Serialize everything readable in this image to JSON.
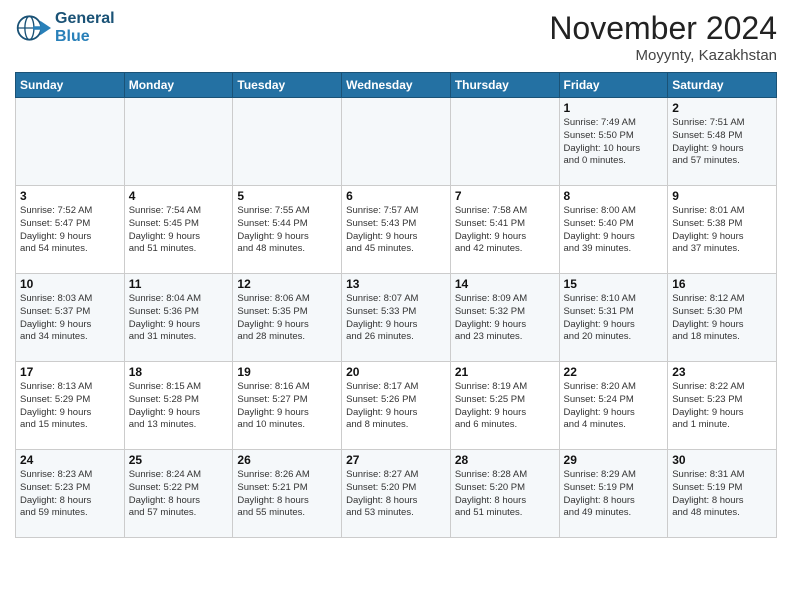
{
  "header": {
    "logo_line1": "General",
    "logo_line2": "Blue",
    "month": "November 2024",
    "location": "Moyynty, Kazakhstan"
  },
  "weekdays": [
    "Sunday",
    "Monday",
    "Tuesday",
    "Wednesday",
    "Thursday",
    "Friday",
    "Saturday"
  ],
  "weeks": [
    [
      {
        "day": "",
        "info": ""
      },
      {
        "day": "",
        "info": ""
      },
      {
        "day": "",
        "info": ""
      },
      {
        "day": "",
        "info": ""
      },
      {
        "day": "",
        "info": ""
      },
      {
        "day": "1",
        "info": "Sunrise: 7:49 AM\nSunset: 5:50 PM\nDaylight: 10 hours\nand 0 minutes."
      },
      {
        "day": "2",
        "info": "Sunrise: 7:51 AM\nSunset: 5:48 PM\nDaylight: 9 hours\nand 57 minutes."
      }
    ],
    [
      {
        "day": "3",
        "info": "Sunrise: 7:52 AM\nSunset: 5:47 PM\nDaylight: 9 hours\nand 54 minutes."
      },
      {
        "day": "4",
        "info": "Sunrise: 7:54 AM\nSunset: 5:45 PM\nDaylight: 9 hours\nand 51 minutes."
      },
      {
        "day": "5",
        "info": "Sunrise: 7:55 AM\nSunset: 5:44 PM\nDaylight: 9 hours\nand 48 minutes."
      },
      {
        "day": "6",
        "info": "Sunrise: 7:57 AM\nSunset: 5:43 PM\nDaylight: 9 hours\nand 45 minutes."
      },
      {
        "day": "7",
        "info": "Sunrise: 7:58 AM\nSunset: 5:41 PM\nDaylight: 9 hours\nand 42 minutes."
      },
      {
        "day": "8",
        "info": "Sunrise: 8:00 AM\nSunset: 5:40 PM\nDaylight: 9 hours\nand 39 minutes."
      },
      {
        "day": "9",
        "info": "Sunrise: 8:01 AM\nSunset: 5:38 PM\nDaylight: 9 hours\nand 37 minutes."
      }
    ],
    [
      {
        "day": "10",
        "info": "Sunrise: 8:03 AM\nSunset: 5:37 PM\nDaylight: 9 hours\nand 34 minutes."
      },
      {
        "day": "11",
        "info": "Sunrise: 8:04 AM\nSunset: 5:36 PM\nDaylight: 9 hours\nand 31 minutes."
      },
      {
        "day": "12",
        "info": "Sunrise: 8:06 AM\nSunset: 5:35 PM\nDaylight: 9 hours\nand 28 minutes."
      },
      {
        "day": "13",
        "info": "Sunrise: 8:07 AM\nSunset: 5:33 PM\nDaylight: 9 hours\nand 26 minutes."
      },
      {
        "day": "14",
        "info": "Sunrise: 8:09 AM\nSunset: 5:32 PM\nDaylight: 9 hours\nand 23 minutes."
      },
      {
        "day": "15",
        "info": "Sunrise: 8:10 AM\nSunset: 5:31 PM\nDaylight: 9 hours\nand 20 minutes."
      },
      {
        "day": "16",
        "info": "Sunrise: 8:12 AM\nSunset: 5:30 PM\nDaylight: 9 hours\nand 18 minutes."
      }
    ],
    [
      {
        "day": "17",
        "info": "Sunrise: 8:13 AM\nSunset: 5:29 PM\nDaylight: 9 hours\nand 15 minutes."
      },
      {
        "day": "18",
        "info": "Sunrise: 8:15 AM\nSunset: 5:28 PM\nDaylight: 9 hours\nand 13 minutes."
      },
      {
        "day": "19",
        "info": "Sunrise: 8:16 AM\nSunset: 5:27 PM\nDaylight: 9 hours\nand 10 minutes."
      },
      {
        "day": "20",
        "info": "Sunrise: 8:17 AM\nSunset: 5:26 PM\nDaylight: 9 hours\nand 8 minutes."
      },
      {
        "day": "21",
        "info": "Sunrise: 8:19 AM\nSunset: 5:25 PM\nDaylight: 9 hours\nand 6 minutes."
      },
      {
        "day": "22",
        "info": "Sunrise: 8:20 AM\nSunset: 5:24 PM\nDaylight: 9 hours\nand 4 minutes."
      },
      {
        "day": "23",
        "info": "Sunrise: 8:22 AM\nSunset: 5:23 PM\nDaylight: 9 hours\nand 1 minute."
      }
    ],
    [
      {
        "day": "24",
        "info": "Sunrise: 8:23 AM\nSunset: 5:23 PM\nDaylight: 8 hours\nand 59 minutes."
      },
      {
        "day": "25",
        "info": "Sunrise: 8:24 AM\nSunset: 5:22 PM\nDaylight: 8 hours\nand 57 minutes."
      },
      {
        "day": "26",
        "info": "Sunrise: 8:26 AM\nSunset: 5:21 PM\nDaylight: 8 hours\nand 55 minutes."
      },
      {
        "day": "27",
        "info": "Sunrise: 8:27 AM\nSunset: 5:20 PM\nDaylight: 8 hours\nand 53 minutes."
      },
      {
        "day": "28",
        "info": "Sunrise: 8:28 AM\nSunset: 5:20 PM\nDaylight: 8 hours\nand 51 minutes."
      },
      {
        "day": "29",
        "info": "Sunrise: 8:29 AM\nSunset: 5:19 PM\nDaylight: 8 hours\nand 49 minutes."
      },
      {
        "day": "30",
        "info": "Sunrise: 8:31 AM\nSunset: 5:19 PM\nDaylight: 8 hours\nand 48 minutes."
      }
    ]
  ]
}
